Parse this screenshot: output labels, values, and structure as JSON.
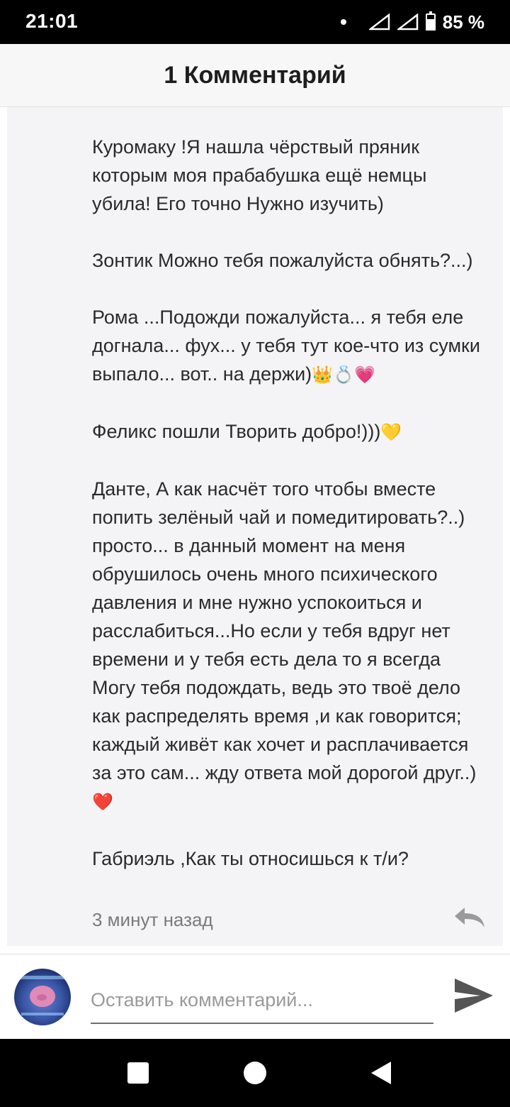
{
  "status_bar": {
    "time": "21:01",
    "battery": "85 %"
  },
  "header": {
    "title": "1 Комментарий"
  },
  "comment": {
    "paragraphs": [
      {
        "text": "Куромаку !Я нашла чёрствый пряник которым моя прабабушка ещё немцы убила! Его точно Нужно изучить)",
        "emoji": ""
      },
      {
        "text": "Зонтик Можно тебя пожалуйста обнять?...)",
        "emoji": ""
      },
      {
        "text": "Рома ...Подожди пожалуйста... я тебя еле догнала... фух... у тебя тут кое-что из сумки выпало... вот.. на держи)",
        "emoji": "👑💍💗"
      },
      {
        "text": "Феликс пошли Творить добро!)))",
        "emoji": "💛"
      },
      {
        "text": "Данте, А как насчёт того чтобы вместе попить зелёный чай и помедитировать?..) просто... в данный момент на меня обрушилось очень много психического давления и мне нужно успокоиться и расслабиться...Но если у тебя вдруг нет времени и у тебя есть дела то я всегда Могу тебя подождать, ведь это твоё дело как распределять время ,и как говорится; каждый живёт как хочет и расплачивается за это сам... жду ответа мой дорогой друг..)",
        "emoji": "❤️"
      },
      {
        "text": "Габриэль ,Как ты относишься к т/и?",
        "emoji": ""
      }
    ],
    "time_ago": "3 минут назад",
    "reply_icon": "reply-icon"
  },
  "input_bar": {
    "placeholder": "Оставить комментарий...",
    "value": "",
    "send_icon": "send-icon"
  },
  "colors": {
    "status_bar_bg": "#000000",
    "header_bg": "#f7f7f7",
    "card_bg": "#f4f3f6",
    "text": "#2a2a2a",
    "muted": "#7a7a7a"
  }
}
